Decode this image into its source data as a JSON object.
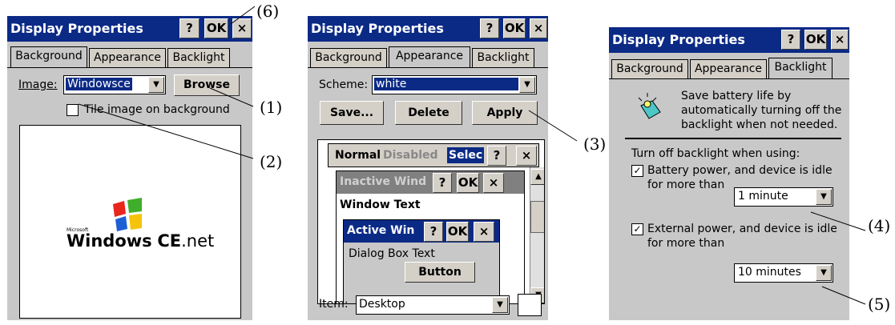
{
  "panel1": {
    "title": "Display Properties",
    "help": "?",
    "ok": "OK",
    "close": "×",
    "tabs": [
      "Background",
      "Appearance",
      "Backlight"
    ],
    "image_label": "Image:",
    "image_value": "Windowsce",
    "browse": "Browse",
    "tile_label": "Tile image on background",
    "preview_ms": "Microsoft",
    "preview_windows": "Windows",
    "preview_ce": "CE",
    "preview_net": ".net"
  },
  "panel2": {
    "title": "Display Properties",
    "help": "?",
    "ok": "OK",
    "close": "×",
    "tabs": [
      "Background",
      "Appearance",
      "Backlight"
    ],
    "scheme_label": "Scheme:",
    "scheme_value": "white",
    "save": "Save...",
    "delete": "Delete",
    "apply": "Apply",
    "preview": {
      "normal": "Normal",
      "disabled": "Disabled",
      "selected": "Selec",
      "inactive": "Inactive Wind",
      "window_text": "Window Text",
      "active": "Active Win",
      "dialog_text": "Dialog Box Text",
      "button": "Button"
    },
    "item_label": "Item:",
    "item_value": "Desktop"
  },
  "panel3": {
    "title": "Display Properties",
    "help": "?",
    "ok": "OK",
    "close": "×",
    "tabs": [
      "Background",
      "Appearance",
      "Backlight"
    ],
    "desc1": "Save battery life by",
    "desc2": "automatically turning off the",
    "desc3": "backlight when not needed.",
    "turnoff": "Turn off backlight when using:",
    "battery1": "Battery power, and device is idle",
    "battery2": "for more than",
    "battery_value": "1 minute",
    "external1": "External power, and device is idle",
    "external2": "for more than",
    "external_value": "10 minutes",
    "check": "✓"
  },
  "callouts": [
    "(1)",
    "(2)",
    "(3)",
    "(4)",
    "(5)",
    "(6)"
  ],
  "colors": {
    "titlebar": "#0b2a86",
    "dialog": "#c8c8c8"
  }
}
